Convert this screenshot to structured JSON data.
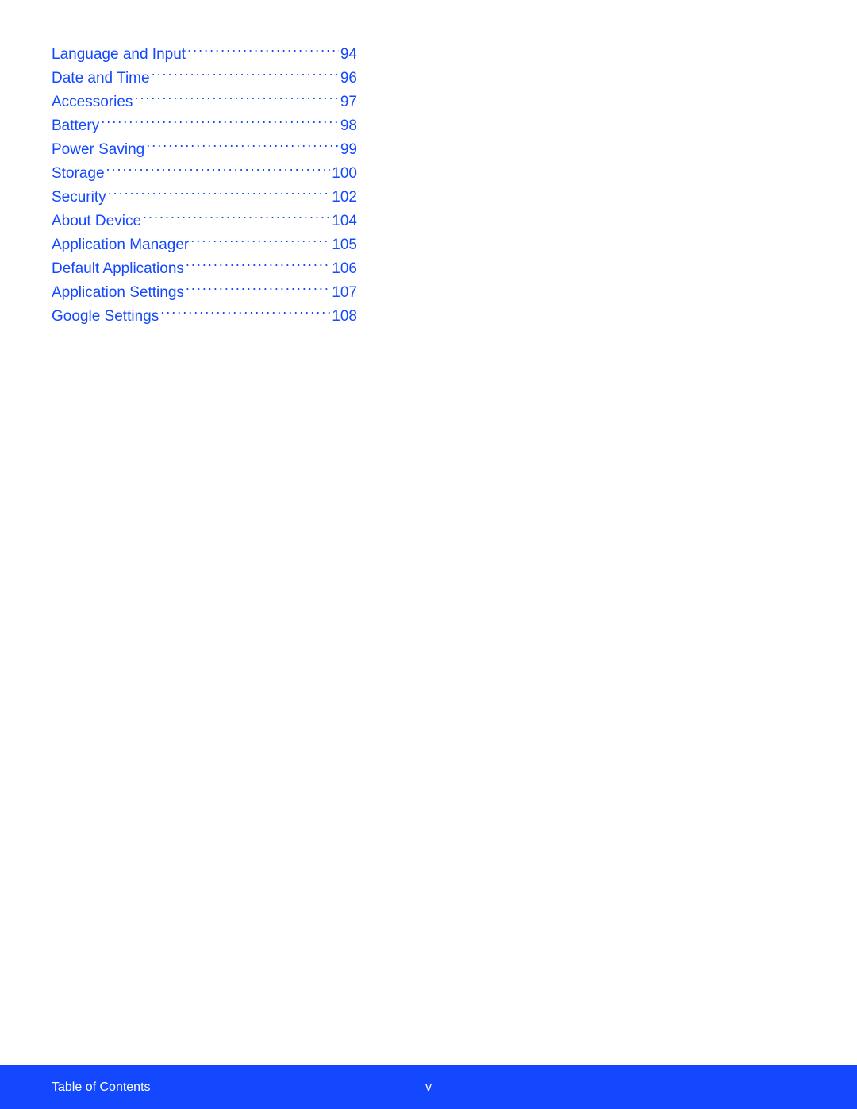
{
  "toc": {
    "entries": [
      {
        "title": "Language and Input",
        "page": "94"
      },
      {
        "title": "Date and Time",
        "page": "96"
      },
      {
        "title": "Accessories",
        "page": "97"
      },
      {
        "title": "Battery",
        "page": "98"
      },
      {
        "title": "Power Saving",
        "page": "99"
      },
      {
        "title": "Storage",
        "page": "100"
      },
      {
        "title": "Security",
        "page": "102"
      },
      {
        "title": "About Device",
        "page": "104"
      },
      {
        "title": "Application Manager",
        "page": "105"
      },
      {
        "title": "Default Applications",
        "page": "106"
      },
      {
        "title": "Application Settings",
        "page": "107"
      },
      {
        "title": "Google Settings",
        "page": "108"
      }
    ]
  },
  "footer": {
    "title": "Table of Contents",
    "page_number": "v"
  }
}
